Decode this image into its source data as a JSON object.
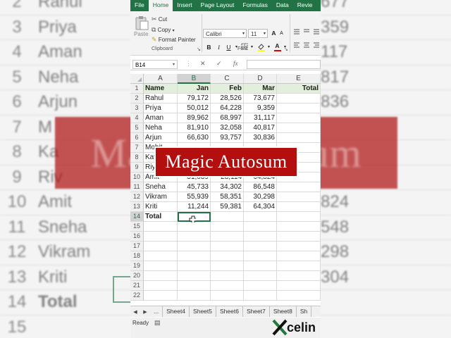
{
  "ribbon": {
    "tabs": [
      "File",
      "Home",
      "Insert",
      "Page Layout",
      "Formulas",
      "Data",
      "Revie"
    ],
    "active_tab": "Home",
    "clipboard": {
      "paste": "Paste",
      "cut": "Cut",
      "copy": "Copy",
      "format_painter": "Format Painter",
      "group_label": "Clipboard"
    },
    "font": {
      "name": "Calibri",
      "size": "11",
      "bold": "B",
      "italic": "I",
      "underline": "U",
      "grow": "A",
      "shrink": "A",
      "font_color": "A",
      "group_label": "Font"
    }
  },
  "formula_bar": {
    "name_box": "B14",
    "cancel": "✕",
    "enter": "✓",
    "fx": "fx",
    "content": ""
  },
  "grid": {
    "columns": [
      "A",
      "B",
      "C",
      "D",
      "E"
    ],
    "row_numbers": [
      "1",
      "2",
      "3",
      "4",
      "5",
      "6",
      "7",
      "8",
      "9",
      "10",
      "11",
      "12",
      "13",
      "14",
      "15",
      "16",
      "17",
      "18",
      "19",
      "20",
      "21",
      "22"
    ],
    "header": [
      "Name",
      "Jan",
      "Feb",
      "Mar",
      "Total"
    ],
    "rows": [
      [
        "Rahul",
        "79,172",
        "28,526",
        "73,677"
      ],
      [
        "Priya",
        "50,012",
        "64,228",
        "9,359"
      ],
      [
        "Aman",
        "89,962",
        "68,997",
        "31,117"
      ],
      [
        "Neha",
        "81,910",
        "32,058",
        "40,817"
      ],
      [
        "Arjun",
        "66,630",
        "93,757",
        "30,836"
      ],
      [
        "Mohit",
        "",
        "",
        ""
      ],
      [
        "Kavya",
        "",
        "",
        ""
      ],
      [
        "Riya",
        "",
        "",
        ""
      ],
      [
        "Amit",
        "51,039",
        "28,114",
        "64,824"
      ],
      [
        "Sneha",
        "45,733",
        "34,302",
        "86,548"
      ],
      [
        "Vikram",
        "55,939",
        "58,351",
        "30,298"
      ],
      [
        "Kriti",
        "11,244",
        "59,381",
        "64,304"
      ]
    ],
    "total_label": "Total"
  },
  "sheet_tabs": {
    "more": "...",
    "tabs": [
      "Sheet4",
      "Sheet5",
      "Sheet6",
      "Sheet7",
      "Sheet8",
      "Sh"
    ]
  },
  "status": {
    "ready": "Ready"
  },
  "overlay": {
    "banner": "Magic Autosum",
    "logo_letter": "X",
    "logo_word": "celin"
  },
  "background": {
    "row_numbers": [
      "2",
      "3",
      "4",
      "5",
      "6",
      "7",
      "8",
      "9",
      "10",
      "11",
      "12",
      "13",
      "14",
      "15"
    ],
    "names": [
      "Rahul",
      "Priya",
      "Aman",
      "Neha",
      "Arjun",
      "M",
      "Ka",
      "Riv",
      "Amit",
      "Sneha",
      "Vikram",
      "Kriti",
      "Total",
      ""
    ],
    "right_values": [
      "677",
      "359",
      "117",
      "817",
      "836",
      "",
      "",
      "",
      "824",
      "548",
      "298",
      "304",
      "",
      ""
    ]
  },
  "colors": {
    "excel_green": "#217346",
    "banner_red": "#b30f0f",
    "header_fill": "#e2efda"
  }
}
